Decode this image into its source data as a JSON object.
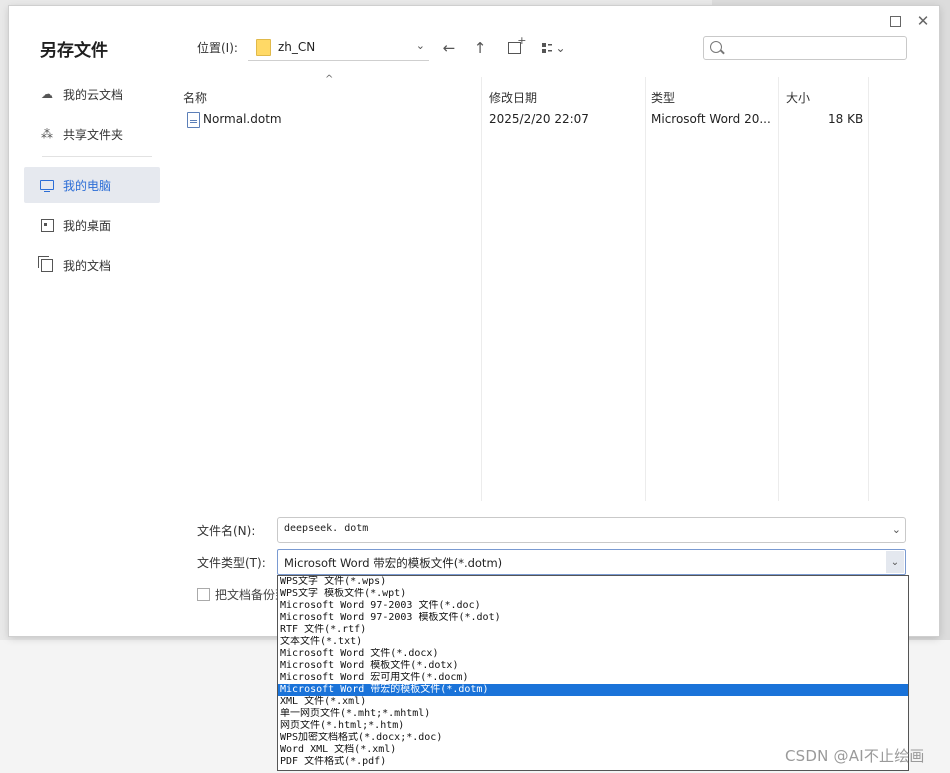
{
  "dialog": {
    "title": "另存文件",
    "location_label": "位置(I):",
    "location_value": "zh_CN",
    "search_placeholder": "",
    "toolbar_icons": [
      "back-arrow-icon",
      "up-arrow-icon",
      "new-folder-icon",
      "view-mode-icon"
    ]
  },
  "sidebar": {
    "items": [
      {
        "label": "我的云文档",
        "icon": "cloud-icon",
        "active": false
      },
      {
        "label": "共享文件夹",
        "icon": "shared-folder-icon",
        "active": false
      },
      {
        "label": "我的电脑",
        "icon": "computer-icon",
        "active": true
      },
      {
        "label": "我的桌面",
        "icon": "desktop-icon",
        "active": false
      },
      {
        "label": "我的文档",
        "icon": "documents-icon",
        "active": false
      }
    ]
  },
  "file_list": {
    "columns": {
      "name": "名称",
      "modified": "修改日期",
      "type": "类型",
      "size": "大小"
    },
    "rows": [
      {
        "name": "Normal.dotm",
        "modified": "2025/2/20 22:07",
        "type": "Microsoft Word 20...",
        "size": "18 KB"
      }
    ]
  },
  "form": {
    "filename_label": "文件名(N):",
    "filename_value": "deepseek. dotm",
    "filetype_label": "文件类型(T):",
    "filetype_value": "Microsoft Word 带宏的模板文件(*.dotm)",
    "backup_label": "把文档备份到"
  },
  "filetype_options": [
    "WPS文字 文件(*.wps)",
    "WPS文字 模板文件(*.wpt)",
    "Microsoft Word 97-2003 文件(*.doc)",
    "Microsoft Word 97-2003 模板文件(*.dot)",
    "RTF 文件(*.rtf)",
    "文本文件(*.txt)",
    "Microsoft Word 文件(*.docx)",
    "Microsoft Word 模板文件(*.dotx)",
    "Microsoft Word 宏可用文件(*.docm)",
    "Microsoft Word 带宏的模板文件(*.dotm)",
    "XML 文件(*.xml)",
    "单一网页文件(*.mht;*.mhtml)",
    "网页文件(*.html;*.htm)",
    "WPS加密文档格式(*.docx;*.doc)",
    "Word XML 文档(*.xml)",
    "PDF 文件格式(*.pdf)"
  ],
  "selected_option_index": 9,
  "watermark": "CSDN @AI不止绘画",
  "colors": {
    "accent": "#2b6dd6",
    "selection": "#1a73d9",
    "sidebar_active_bg": "#e6e9ef"
  }
}
